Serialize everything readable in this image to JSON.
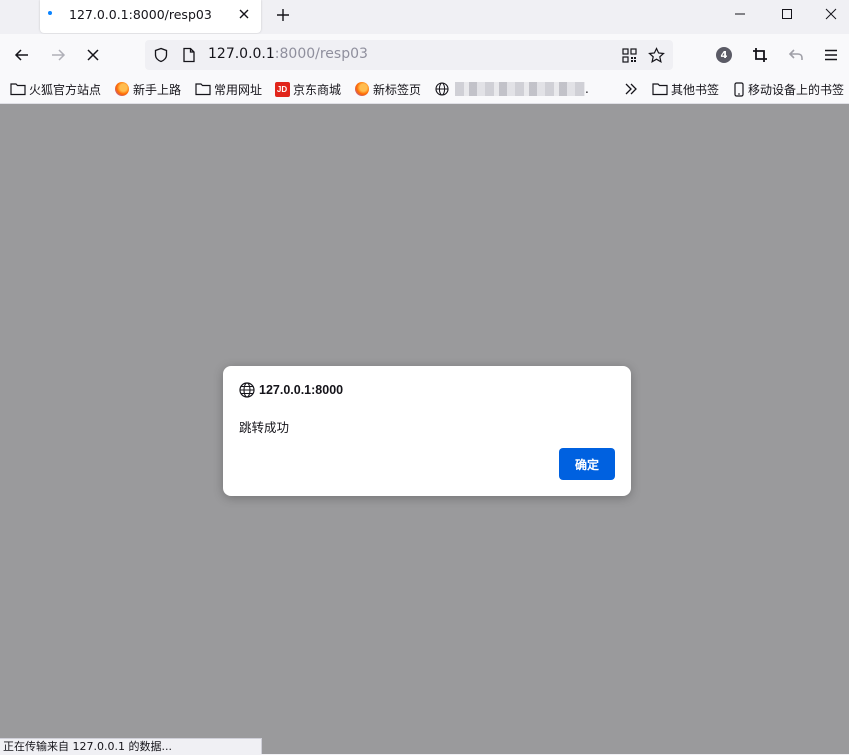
{
  "tab": {
    "title": "127.0.0.1:8000/resp03"
  },
  "urlbar": {
    "host": "127.0.0.1",
    "rest": ":8000/resp03"
  },
  "toolbar": {
    "extension_badge": "4"
  },
  "bookmarks": {
    "items": [
      {
        "label": "火狐官方站点",
        "icon": "folder-icon"
      },
      {
        "label": "新手上路",
        "icon": "firefox-icon"
      },
      {
        "label": "常用网址",
        "icon": "folder-icon"
      },
      {
        "label": "京东商城",
        "icon": "jd-icon",
        "icon_text": "JD"
      },
      {
        "label": "新标签页",
        "icon": "firefox-icon"
      },
      {
        "label": ".",
        "icon": "globe-icon"
      }
    ],
    "other_label": "其他书签",
    "mobile_label": "移动设备上的书签"
  },
  "dialog": {
    "origin": "127.0.0.1:8000",
    "message": "跳转成功",
    "ok_label": "确定"
  },
  "status": {
    "text": "正在传输来自 127.0.0.1 的数据..."
  },
  "colors": {
    "accent": "#0061e0",
    "overlay": "#9a9a9c",
    "tab_dot": "#0a84ff",
    "jd_red": "#e1251b"
  }
}
